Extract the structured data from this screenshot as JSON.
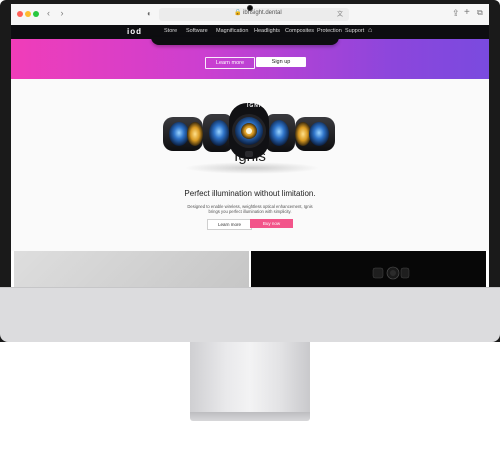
{
  "browser": {
    "nav_arrows": "‹ ›",
    "contrast_icon": "◐",
    "address": "ibnsight.dental",
    "lock_icon": "🔒",
    "translate_icon": "文",
    "reload_icon": "↻",
    "share_icon": "⇪",
    "new_tab_icon": "+",
    "tabs_icon": "⧉"
  },
  "nav": {
    "logo": "iod",
    "items": [
      "Store",
      "Software",
      "Magnification",
      "Headlights",
      "Composites",
      "Protection",
      "Support"
    ],
    "bag_icon": "⌂"
  },
  "promo": {
    "learn_more": "Learn more",
    "sign_up": "Sign up",
    "gradient": [
      "#f03db9",
      "#7a4adf"
    ]
  },
  "hero": {
    "product_label": "IGNIS",
    "title": "Ignis",
    "subtitle": "Perfect illumination without limitation.",
    "description": "Designed to enable wireless, weightless optical enhancement, Ignis brings you perfect illumination with simplicity.",
    "learn_more": "Learn more",
    "buy_now": "Buy now",
    "buy_color": "#f2558a"
  }
}
